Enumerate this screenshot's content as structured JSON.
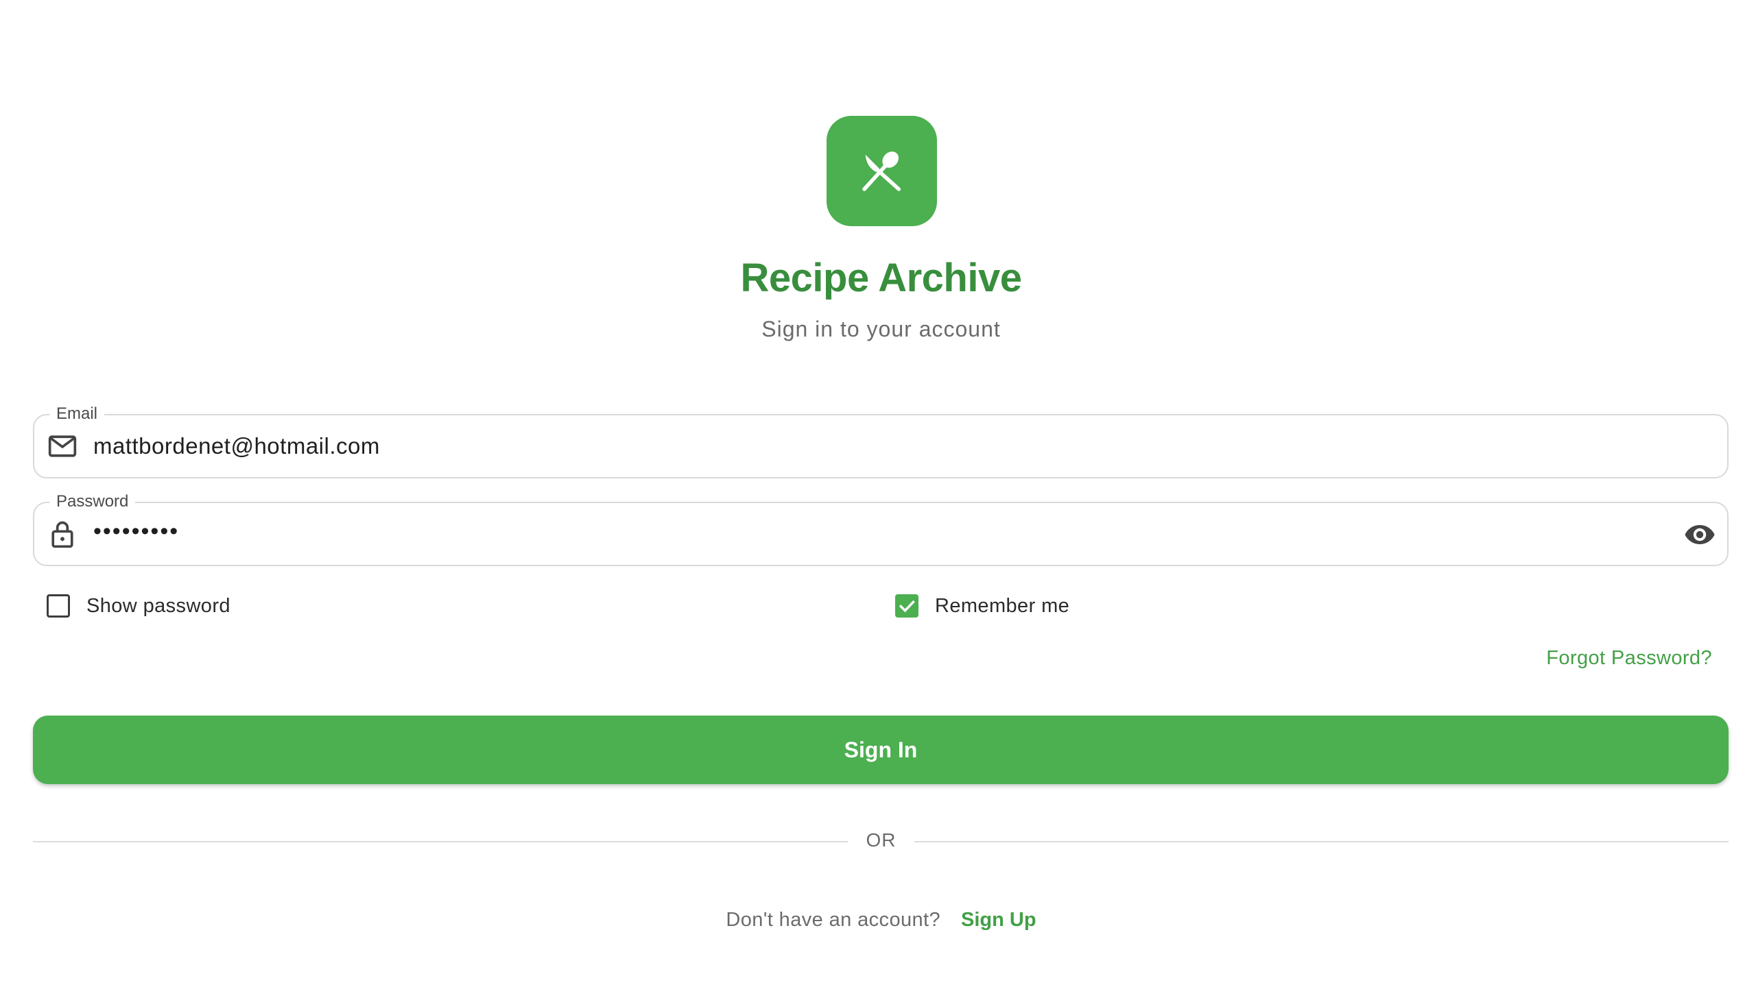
{
  "brand": {
    "title": "Recipe Archive",
    "subtitle": "Sign in to your account",
    "logo_icon": "fork-spoon-icon",
    "accent_color": "#4caf50",
    "title_color": "#388e3c"
  },
  "form": {
    "email": {
      "label": "Email",
      "value": "mattbordenet@hotmail.com",
      "icon": "mail-icon"
    },
    "password": {
      "label": "Password",
      "masked_value": "•••••••••",
      "icon": "lock-icon",
      "toggle_icon": "eye-icon"
    },
    "show_password": {
      "label": "Show password",
      "checked": false
    },
    "remember_me": {
      "label": "Remember me",
      "checked": true
    },
    "forgot_password": "Forgot Password?",
    "submit_label": "Sign In"
  },
  "divider": {
    "text": "OR"
  },
  "signup": {
    "prompt": "Don't have an account?",
    "link": "Sign Up"
  }
}
